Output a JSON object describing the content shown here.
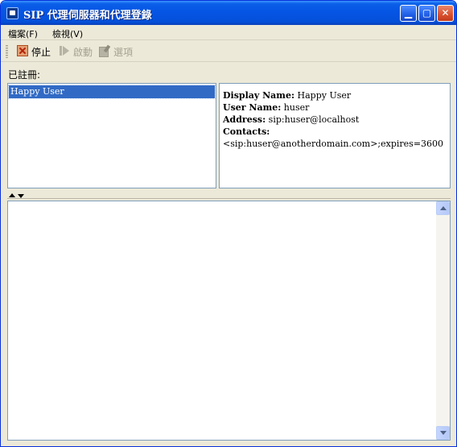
{
  "window": {
    "title": "SIP 代理伺服器和代理登錄",
    "minimize": "▁",
    "maximize": "▢",
    "close": "✕"
  },
  "menu": {
    "file": "檔案(F)",
    "view": "檢視(V)"
  },
  "toolbar": {
    "stop": "停止",
    "start": "啟動",
    "options": "選項"
  },
  "registered": {
    "label": "已註冊:",
    "items": [
      "Happy User"
    ]
  },
  "details": {
    "display_name_key": "Display Name:",
    "display_name_value": "Happy User",
    "user_name_key": "User Name:",
    "user_name_value": "huser",
    "address_key": "Address:",
    "address_value": "sip:huser@localhost",
    "contacts_key": "Contacts:",
    "contacts_value": "<sip:huser@anotherdomain.com>;expires=3600"
  },
  "icons": {
    "app": "app-icon",
    "stop": "stop-icon",
    "start": "play-icon",
    "options": "options-icon"
  },
  "colors": {
    "titlebar": "#0554e3",
    "selection": "#316ac5",
    "window_bg": "#ece9d8"
  }
}
